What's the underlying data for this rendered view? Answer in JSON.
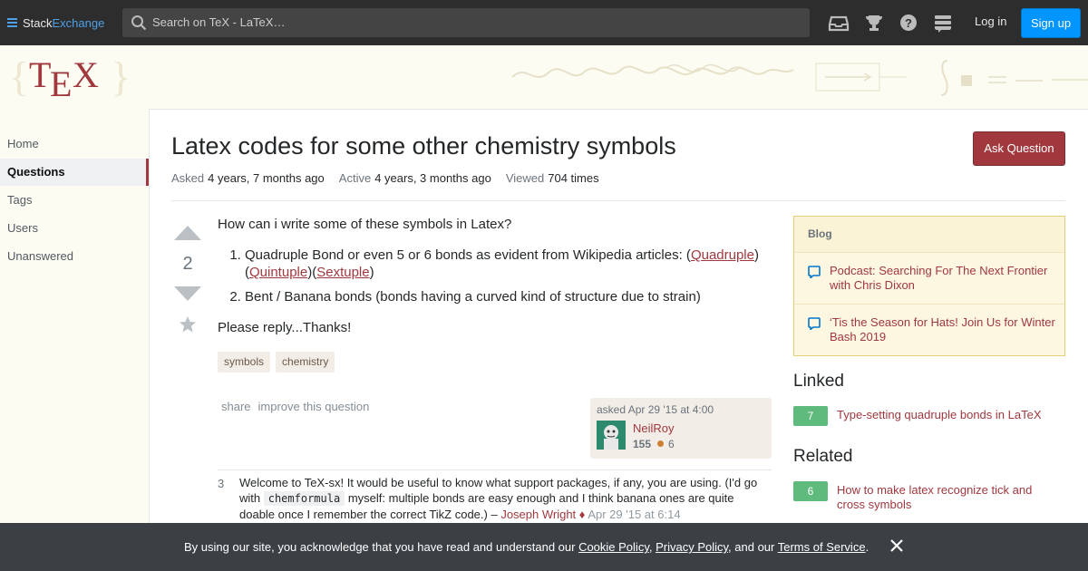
{
  "topbar": {
    "logo_part1": "Stack",
    "logo_part2": "Exchange",
    "search_placeholder": "Search on TeX - LaTeX…",
    "icons": [
      "inbox-icon",
      "trophy-icon",
      "help-icon",
      "site-switcher-icon"
    ],
    "login_label": "Log in",
    "signup_label": "Sign up"
  },
  "banner": {
    "logo_text": "TeX"
  },
  "nav": {
    "items": [
      {
        "label": "Home",
        "active": false
      },
      {
        "label": "Questions",
        "active": true
      },
      {
        "label": "Tags",
        "active": false
      },
      {
        "label": "Users",
        "active": false
      },
      {
        "label": "Unanswered",
        "active": false
      }
    ]
  },
  "question": {
    "title": "Latex codes for some other chemistry symbols",
    "ask_label": "Ask Question",
    "asked_label": "Asked",
    "asked_value": "4 years, 7 months ago",
    "active_label": "Active",
    "active_value": "4 years, 3 months ago",
    "viewed_label": "Viewed",
    "viewed_value": "704 times",
    "vote_count": "2",
    "body_intro": "How can i write some of these symbols in Latex?",
    "list_item1_text": "Quadruple Bond or even 5 or 6 bonds as evident from Wikipedia articles: (",
    "link_quadruple": "Quadruple",
    "list_item1_mid": ")",
    "list_item1_open2": "(",
    "link_quintuple": "Quintuple",
    "list_item1_mid2": ")(",
    "link_sextuple": "Sextuple",
    "list_item1_end": ")",
    "list_item2_text": "Bent / Banana bonds (bonds having a curved kind of structure due to strain)",
    "body_outro": "Please reply...Thanks!",
    "tags": [
      "symbols",
      "chemistry"
    ],
    "share_label": "share",
    "improve_label": "improve this question",
    "owner": {
      "asked_text": "asked Apr 29 '15 at 4:00",
      "name": "NeilRoy",
      "reputation": "155",
      "bronze": "6"
    }
  },
  "comment": {
    "score": "3",
    "text_before": "Welcome to TeX-sx! It would be useful to know what support packages, if any, you are using. (I'd go with ",
    "code": "chemformula",
    "text_after": " myself: multiple bonds are easy enough and I think banana ones are quite doable once I remember the correct TikZ code.) – ",
    "user": "Joseph Wright ♦",
    "date": "Apr 29 '15 at 6:14"
  },
  "sidebar": {
    "blog_header": "Blog",
    "blog_items": [
      "Podcast: Searching For The Next Frontier with Chris Dixon",
      "‘Tis the Season for Hats! Join Us for Winter Bash 2019"
    ],
    "linked_header": "Linked",
    "linked": [
      {
        "count": "7",
        "title": "Type-setting quadruple bonds in LaTeX"
      }
    ],
    "related_header": "Related",
    "related": [
      {
        "count": "6",
        "title": "How to make latex recognize tick and cross symbols"
      }
    ]
  },
  "cookie": {
    "text1": "By using our site, you acknowledge that you have read and understand our ",
    "link1": "Cookie Policy",
    "text2": ", ",
    "link2": "Privacy Policy",
    "text3": ", and our ",
    "link3": "Terms of Service",
    "text4": "."
  },
  "colors": {
    "accent": "#a0383e",
    "topbar": "#2d2d2d",
    "signup": "#0095ff",
    "count_green": "#5fba7d"
  }
}
